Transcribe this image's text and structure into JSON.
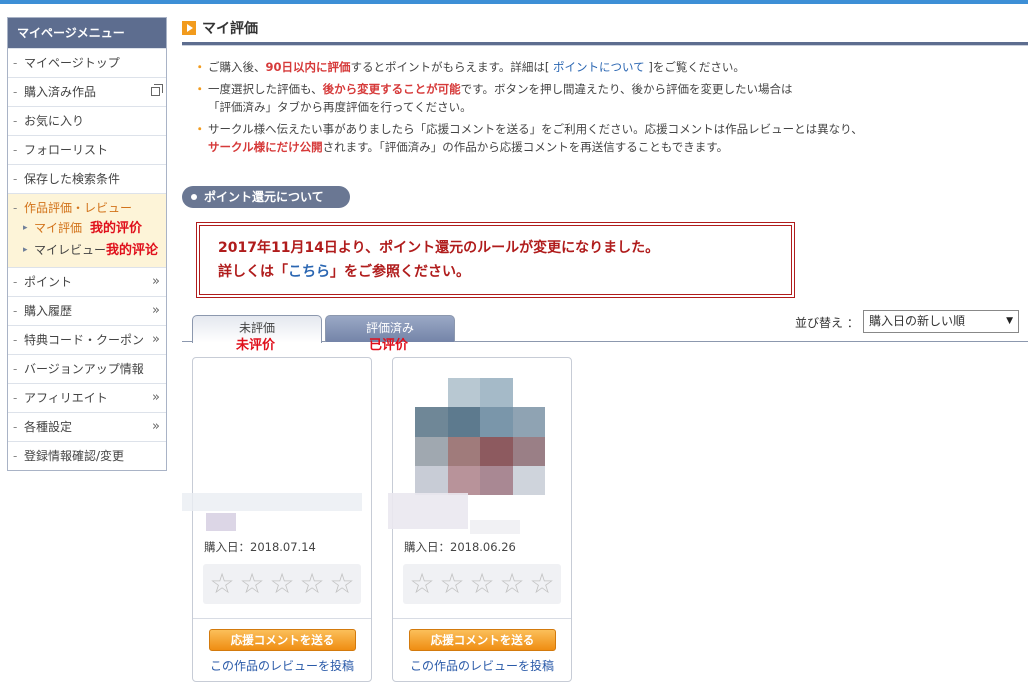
{
  "sidebar": {
    "header": "マイページメニュー",
    "items_top": [
      {
        "label": "マイページトップ"
      },
      {
        "label": "購入済み作品"
      },
      {
        "label": "お気に入り"
      },
      {
        "label": "フォローリスト"
      },
      {
        "label": "保存した検索条件"
      }
    ],
    "active_group": {
      "title": "作品評価・レビュー",
      "subs": [
        {
          "label": "マイ評価",
          "annotation": "我的评价"
        },
        {
          "label": "マイレビュー",
          "annotation": "我的评论"
        }
      ]
    },
    "items_bottom": [
      {
        "label": "ポイント",
        "arrow": "»"
      },
      {
        "label": "購入履歴",
        "arrow": "»"
      },
      {
        "label": "特典コード・クーポン",
        "arrow": "»"
      },
      {
        "label": "バージョンアップ情報",
        "arrow": ""
      },
      {
        "label": "アフィリエイト",
        "arrow": "»"
      },
      {
        "label": "各種設定",
        "arrow": "»"
      },
      {
        "label": "登録情報確認/変更",
        "arrow": ""
      }
    ]
  },
  "page_title": "マイ評価",
  "notes": {
    "n1_a": "ご購入後、",
    "n1_hl": "90日以内に評価",
    "n1_b": "するとポイントがもらえます。詳細は[ ",
    "n1_link": "ポイントについて",
    "n1_c": " ]をご覧ください。",
    "n2_a": "一度選択した評価も、",
    "n2_hl": "後から変更することが可能",
    "n2_b": "です。ボタンを押し間違えたり、後から評価を変更したい場合は",
    "n2_c": "「評価済み」タブから再度評価を行ってください。",
    "n3_a": "サークル様へ伝えたい事がありましたら「応援コメントを送る」をご利用ください。応援コメントは作品レビューとは異なり、",
    "n3_hl": "サークル様にだけ公開",
    "n3_b": "されます。「評価済み」の作品から応援コメントを再送信することもできます。"
  },
  "section_pill": "ポイント還元について",
  "notice": {
    "line1": "2017年11月14日より、ポイント還元のルールが変更になりました。",
    "line2_a": "詳しくは「",
    "line2_link": "こちら",
    "line2_b": "」をご参照ください。"
  },
  "tabs": [
    {
      "label": "未評価",
      "annotation": "未评价"
    },
    {
      "label": "評価済み",
      "annotation": "已评价"
    }
  ],
  "sort": {
    "label": "並び替え ：",
    "selected": "購入日の新しい順"
  },
  "cards": [
    {
      "date": "購入日：2018.07.14",
      "rating": 0,
      "support_button": "応援コメントを送る",
      "review_link": "この作品のレビューを投稿"
    },
    {
      "date": "購入日：2018.06.26",
      "rating": 0,
      "support_button": "応援コメントを送る",
      "review_link": "この作品のレビューを投稿"
    }
  ],
  "star_glyph": "☆"
}
